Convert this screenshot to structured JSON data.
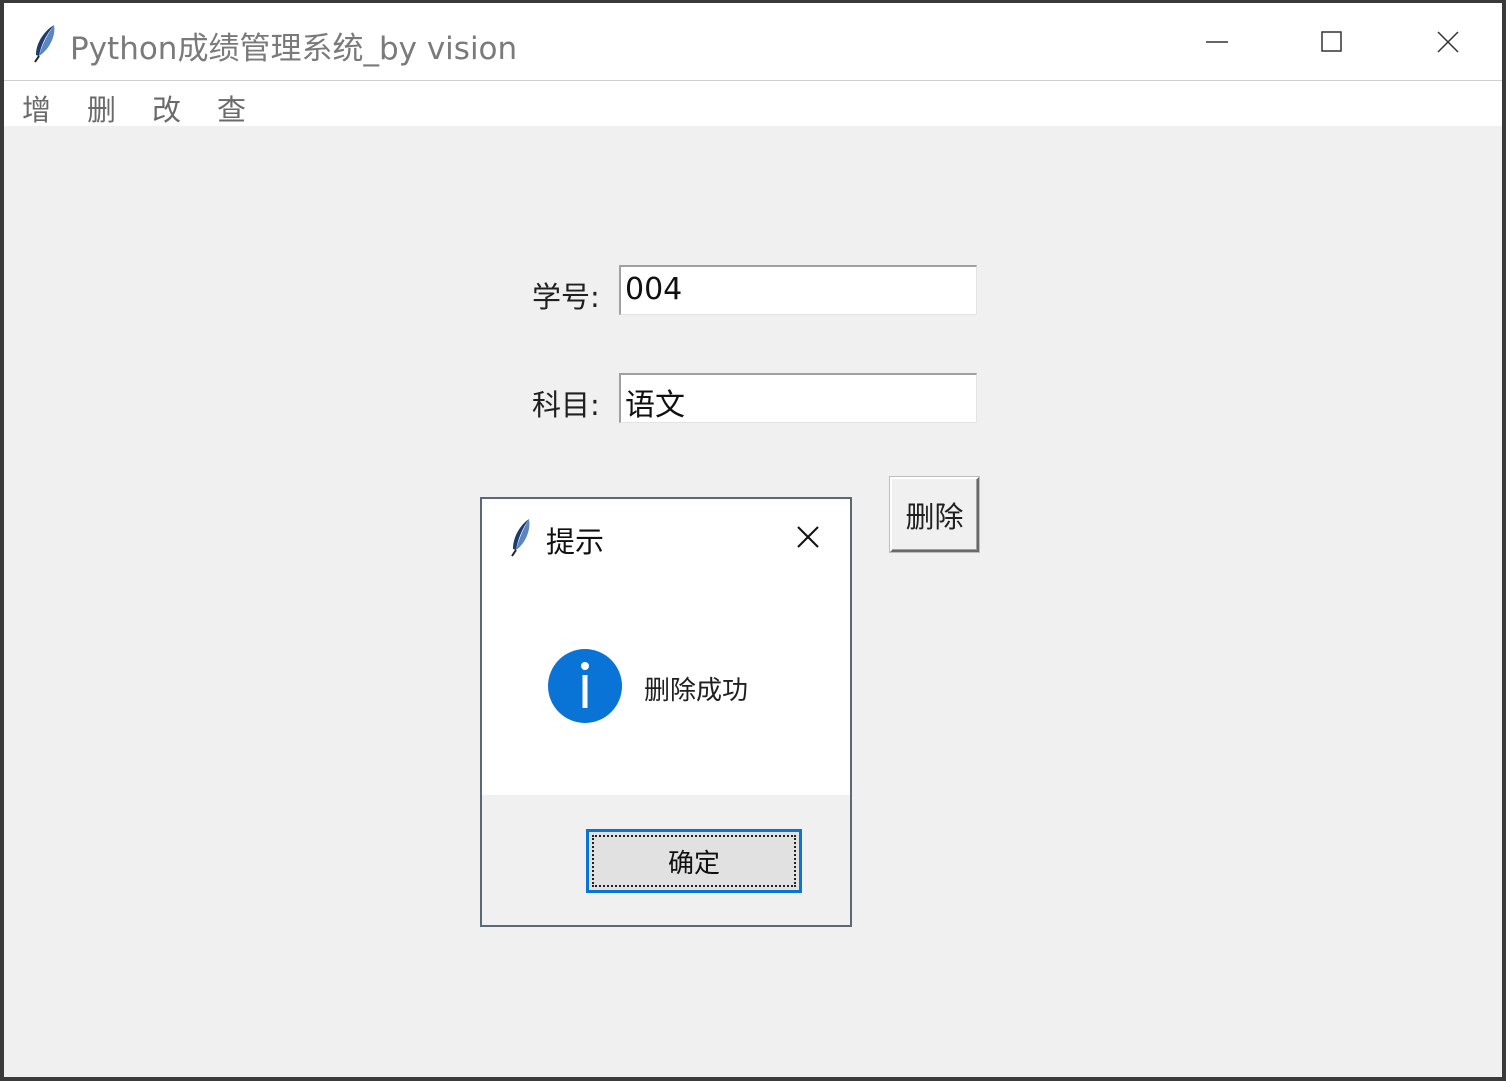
{
  "window": {
    "title": "Python成绩管理系统_by vision",
    "minimize_icon": "minimize-icon",
    "maximize_icon": "maximize-icon",
    "close_icon": "close-icon"
  },
  "menubar": {
    "items": [
      {
        "label": "增"
      },
      {
        "label": "删"
      },
      {
        "label": "改"
      },
      {
        "label": "查"
      }
    ]
  },
  "form": {
    "student_id_label": "学号:",
    "student_id_value": "004",
    "subject_label": "科目:",
    "subject_value": "语文",
    "delete_button_label": "删除"
  },
  "dialog": {
    "title": "提示",
    "message": "删除成功",
    "icon": "info-icon",
    "ok_label": "确定"
  },
  "colors": {
    "info_blue": "#0a73d6",
    "window_bg": "#f0f0f0"
  }
}
